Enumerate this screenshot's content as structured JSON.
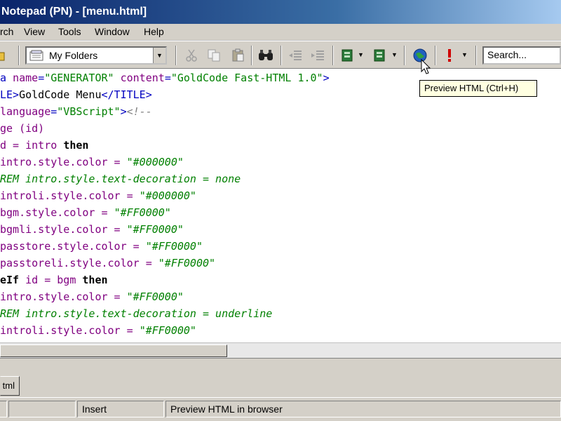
{
  "window": {
    "title": "Notepad (PN) - [menu.html]"
  },
  "menu": {
    "items": [
      "rch",
      "View",
      "Tools",
      "Window",
      "Help"
    ]
  },
  "toolbar": {
    "folder_selector": "My Folders",
    "search_placeholder": "Search...",
    "buttons": [
      {
        "icon": "open-icon"
      },
      {
        "icon": "cut-icon"
      },
      {
        "icon": "copy-icon"
      },
      {
        "icon": "paste-icon"
      },
      {
        "icon": "find-icon"
      },
      {
        "icon": "outdent-icon"
      },
      {
        "icon": "indent-icon"
      },
      {
        "icon": "tool-a-icon"
      },
      {
        "icon": "tool-b-icon"
      },
      {
        "icon": "preview-html-icon"
      },
      {
        "icon": "exclamation-icon"
      }
    ]
  },
  "tooltip": {
    "text": "Preview HTML (Ctrl+H)"
  },
  "editor": {
    "lines": [
      [
        {
          "t": "tag",
          "v": "a "
        },
        {
          "t": "attr",
          "v": "name"
        },
        {
          "t": "tag",
          "v": "="
        },
        {
          "t": "str",
          "v": "\"GENERATOR\""
        },
        {
          "t": "tag",
          "v": " "
        },
        {
          "t": "attr",
          "v": "content"
        },
        {
          "t": "tag",
          "v": "="
        },
        {
          "t": "str",
          "v": "\"GoldCode Fast-HTML 1.0\""
        },
        {
          "t": "tag",
          "v": ">"
        }
      ],
      [
        {
          "t": "tag",
          "v": "LE>"
        },
        {
          "t": "plain",
          "v": "GoldCode Menu"
        },
        {
          "t": "tag",
          "v": "</TITLE>"
        }
      ],
      [
        {
          "t": "attr",
          "v": "language"
        },
        {
          "t": "tag",
          "v": "="
        },
        {
          "t": "str",
          "v": "\"VBScript\""
        },
        {
          "t": "tag",
          "v": ">"
        },
        {
          "t": "cmt",
          "v": "<!--"
        }
      ],
      [
        {
          "t": "var",
          "v": "ge (id)"
        }
      ],
      [
        {
          "t": "var",
          "v": "d = intro "
        },
        {
          "t": "kw",
          "v": "then"
        }
      ],
      [
        {
          "t": "var",
          "v": "intro.style.color = "
        },
        {
          "t": "rem",
          "v": "\"#000000\""
        }
      ],
      [
        {
          "t": "rem",
          "v": "REM intro.style.text-decoration = none"
        }
      ],
      [
        {
          "t": "var",
          "v": "introli.style.color = "
        },
        {
          "t": "rem",
          "v": "\"#000000\""
        }
      ],
      [
        {
          "t": "var",
          "v": "bgm.style.color = "
        },
        {
          "t": "rem",
          "v": "\"#FF0000\""
        }
      ],
      [
        {
          "t": "var",
          "v": "bgmli.style.color = "
        },
        {
          "t": "rem",
          "v": "\"#FF0000\""
        }
      ],
      [
        {
          "t": "var",
          "v": "passtore.style.color = "
        },
        {
          "t": "rem",
          "v": "\"#FF0000\""
        }
      ],
      [
        {
          "t": "var",
          "v": "passtoreli.style.color = "
        },
        {
          "t": "rem",
          "v": "\"#FF0000\""
        }
      ],
      [
        {
          "t": "kw",
          "v": "eIf "
        },
        {
          "t": "var",
          "v": "id = bgm "
        },
        {
          "t": "kw",
          "v": "then"
        }
      ],
      [
        {
          "t": "var",
          "v": "intro.style.color = "
        },
        {
          "t": "rem",
          "v": "\"#FF0000\""
        }
      ],
      [
        {
          "t": "rem",
          "v": "REM intro.style.text-decoration = underline"
        }
      ],
      [
        {
          "t": "var",
          "v": "introli.style.color = "
        },
        {
          "t": "rem",
          "v": "\"#FF0000\""
        }
      ]
    ]
  },
  "tabs": {
    "active": "tml"
  },
  "status": {
    "panel1": "",
    "panel2": "",
    "mode": "Insert",
    "message": "Preview HTML in browser"
  }
}
